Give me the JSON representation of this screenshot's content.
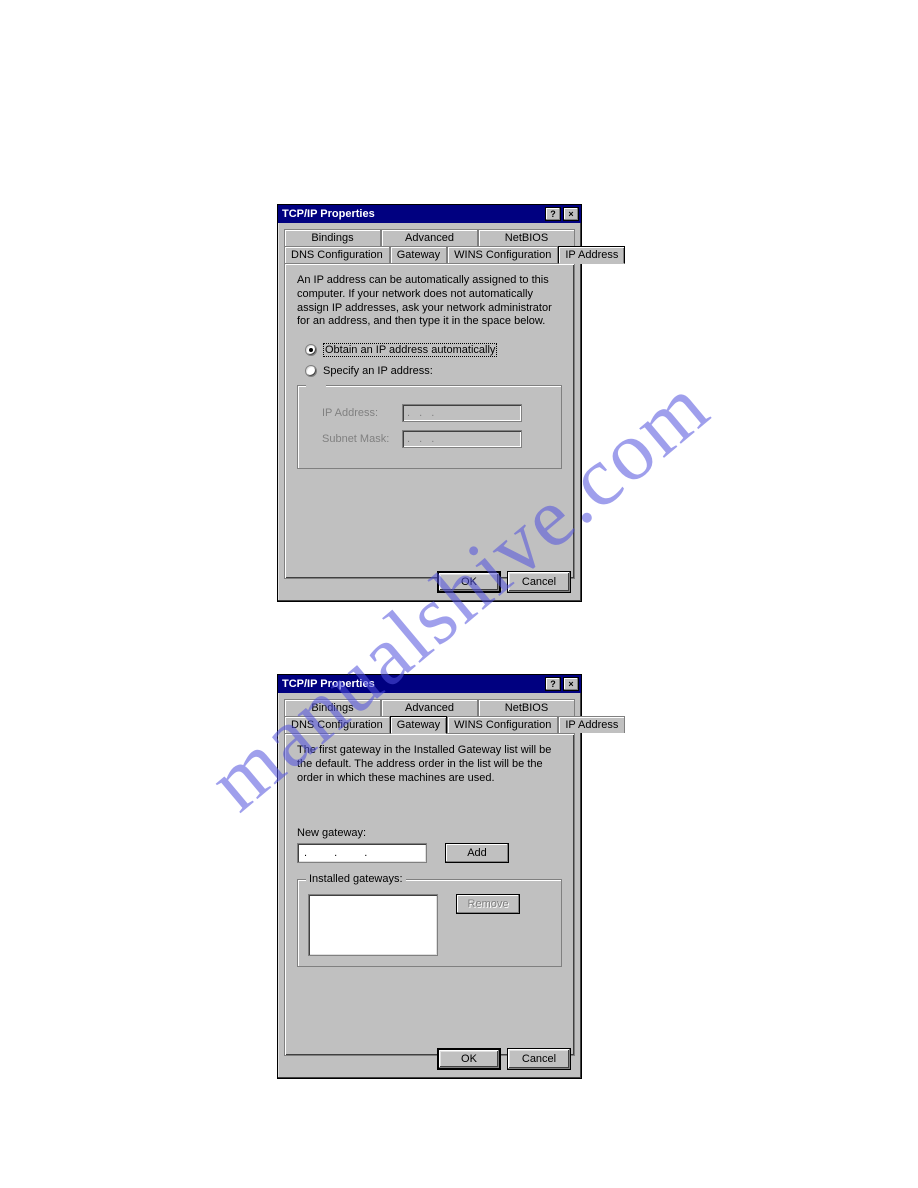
{
  "watermark": "manualshive.com",
  "dialog1": {
    "title": "TCP/IP Properties",
    "help_btn": "?",
    "close_btn": "×",
    "tabs_row1": [
      "Bindings",
      "Advanced",
      "NetBIOS"
    ],
    "tabs_row2": [
      "DNS Configuration",
      "Gateway",
      "WINS Configuration",
      "IP Address"
    ],
    "active_tab": "IP Address",
    "description": "An IP address can be automatically assigned to this computer. If your network does not automatically assign IP addresses, ask your network administrator for an address, and then type it in the space below.",
    "radio_auto": "Obtain an IP address automatically",
    "radio_specify": "Specify an IP address:",
    "radio_selected": "auto",
    "ip_label": "IP Address:",
    "subnet_label": "Subnet Mask:",
    "ip_value": ".   .   .",
    "subnet_value": ".   .   .",
    "ok": "OK",
    "cancel": "Cancel"
  },
  "dialog2": {
    "title": "TCP/IP Properties",
    "help_btn": "?",
    "close_btn": "×",
    "tabs_row1": [
      "Bindings",
      "Advanced",
      "NetBIOS"
    ],
    "tabs_row2": [
      "DNS Configuration",
      "Gateway",
      "WINS Configuration",
      "IP Address"
    ],
    "active_tab": "Gateway",
    "description": "The first gateway in the Installed Gateway list will be the default. The address order in the list will be the order in which these machines are used.",
    "new_gateway_label": "New gateway:",
    "new_gateway_value": ".   .   .",
    "add": "Add",
    "installed_label": "Installed gateways:",
    "remove": "Remove",
    "ok": "OK",
    "cancel": "Cancel"
  }
}
